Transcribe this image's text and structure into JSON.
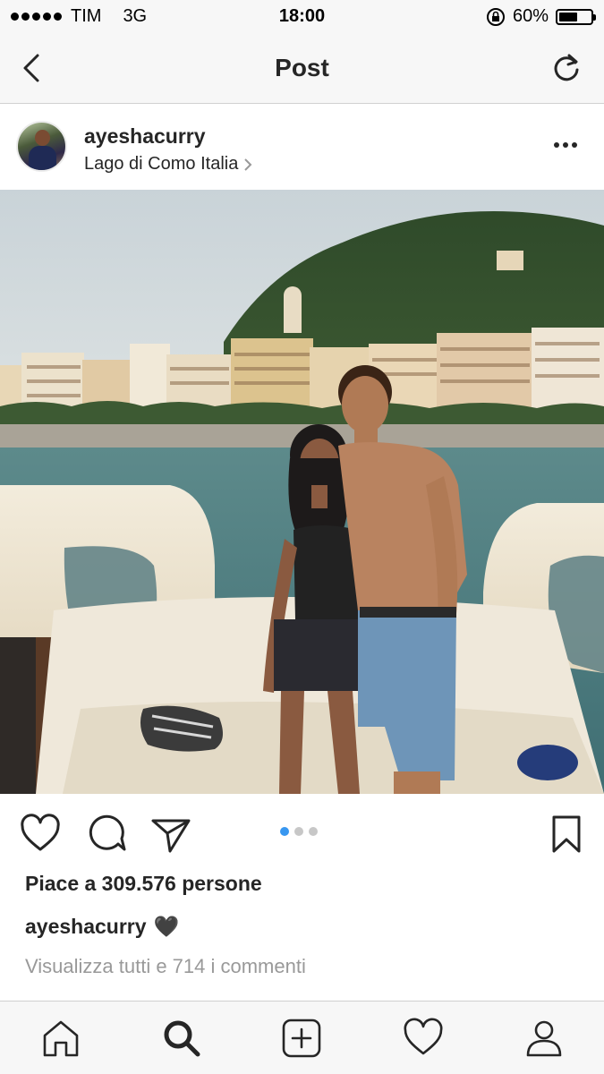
{
  "status_bar": {
    "carrier": "TIM",
    "network": "3G",
    "time": "18:00",
    "battery": "60%",
    "battery_level": 0.6
  },
  "nav": {
    "title": "Post",
    "back_icon": "chevron-left-icon",
    "refresh_icon": "refresh-icon"
  },
  "post": {
    "username": "ayeshacurry",
    "location": "Lago di Como Italia",
    "likes": "Piace a 309.576 persone",
    "caption_username": "ayeshacurry",
    "caption_text": "🖤",
    "view_comments": "Visualizza tutti e 714 i commenti",
    "carousel": {
      "count": 3,
      "active": 0
    }
  },
  "colors": {
    "accent": "#3897f0",
    "text": "#262626",
    "muted": "#999999",
    "bar_bg": "#f7f7f7"
  },
  "tabs": [
    {
      "name": "home",
      "icon": "home-icon"
    },
    {
      "name": "search",
      "icon": "search-icon"
    },
    {
      "name": "add",
      "icon": "add-post-icon"
    },
    {
      "name": "activity",
      "icon": "heart-icon"
    },
    {
      "name": "profile",
      "icon": "profile-icon"
    }
  ]
}
